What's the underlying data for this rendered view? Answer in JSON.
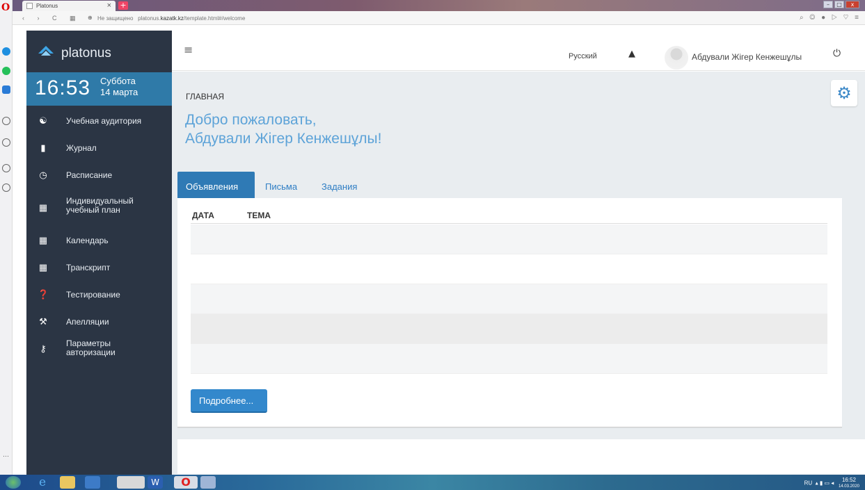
{
  "browser": {
    "tab_title": "Platonus",
    "new_tab": "+",
    "address_security": "Не защищено",
    "address_host_prefix": "platonus.",
    "address_host_bold": "kazatk.kz",
    "address_path": "/template.html#/welcome"
  },
  "brand": {
    "name": "platonus"
  },
  "clock": {
    "time": "16:53",
    "day": "Суббота",
    "date": "14 марта"
  },
  "sidebar": {
    "items": [
      {
        "label": "Учебная аудитория",
        "icon": "users-icon"
      },
      {
        "label": "Журнал",
        "icon": "book-icon"
      },
      {
        "label": "Расписание",
        "icon": "clock-icon"
      },
      {
        "label": "Индивидуальный учебный план",
        "label_line1": "Индивидуальный",
        "label_line2": "учебный план",
        "icon": "grid-icon"
      },
      {
        "label": "Календарь",
        "icon": "calendar-icon"
      },
      {
        "label": "Транскрипт",
        "icon": "table-icon"
      },
      {
        "label": "Тестирование",
        "icon": "question-icon"
      },
      {
        "label": "Апелляции",
        "icon": "gavel-icon"
      },
      {
        "label": "Параметры авторизации",
        "label_line1": "Параметры",
        "label_line2": "авторизации",
        "icon": "key-icon"
      }
    ]
  },
  "header": {
    "language": "Русский",
    "user_name": "Абдували Жігер Кенжешұлы"
  },
  "main": {
    "breadcrumb": "ГЛАВНАЯ",
    "welcome_line1": "Добро пожаловать,",
    "welcome_line2": "Абдували Жігер Кенжешұлы!",
    "tabs": [
      {
        "label": "Объявления",
        "active": true
      },
      {
        "label": "Письма",
        "active": false
      },
      {
        "label": "Задания",
        "active": false
      }
    ],
    "table": {
      "columns": [
        "ДАТА",
        "ТЕМА"
      ],
      "rows": [
        {
          "date": "",
          "subject": "",
          "shade": "#f4f5f6"
        },
        {
          "date": "",
          "subject": "",
          "shade": "#ffffff"
        },
        {
          "date": "",
          "subject": "",
          "shade": "#f4f5f6"
        },
        {
          "date": "",
          "subject": "",
          "shade": "#ececec"
        },
        {
          "date": "",
          "subject": "",
          "shade": "#f4f5f6"
        }
      ]
    },
    "more_button": "Подробнее..."
  },
  "taskbar": {
    "lang": "RU",
    "time": "16:52",
    "date": "14.03.2020"
  }
}
